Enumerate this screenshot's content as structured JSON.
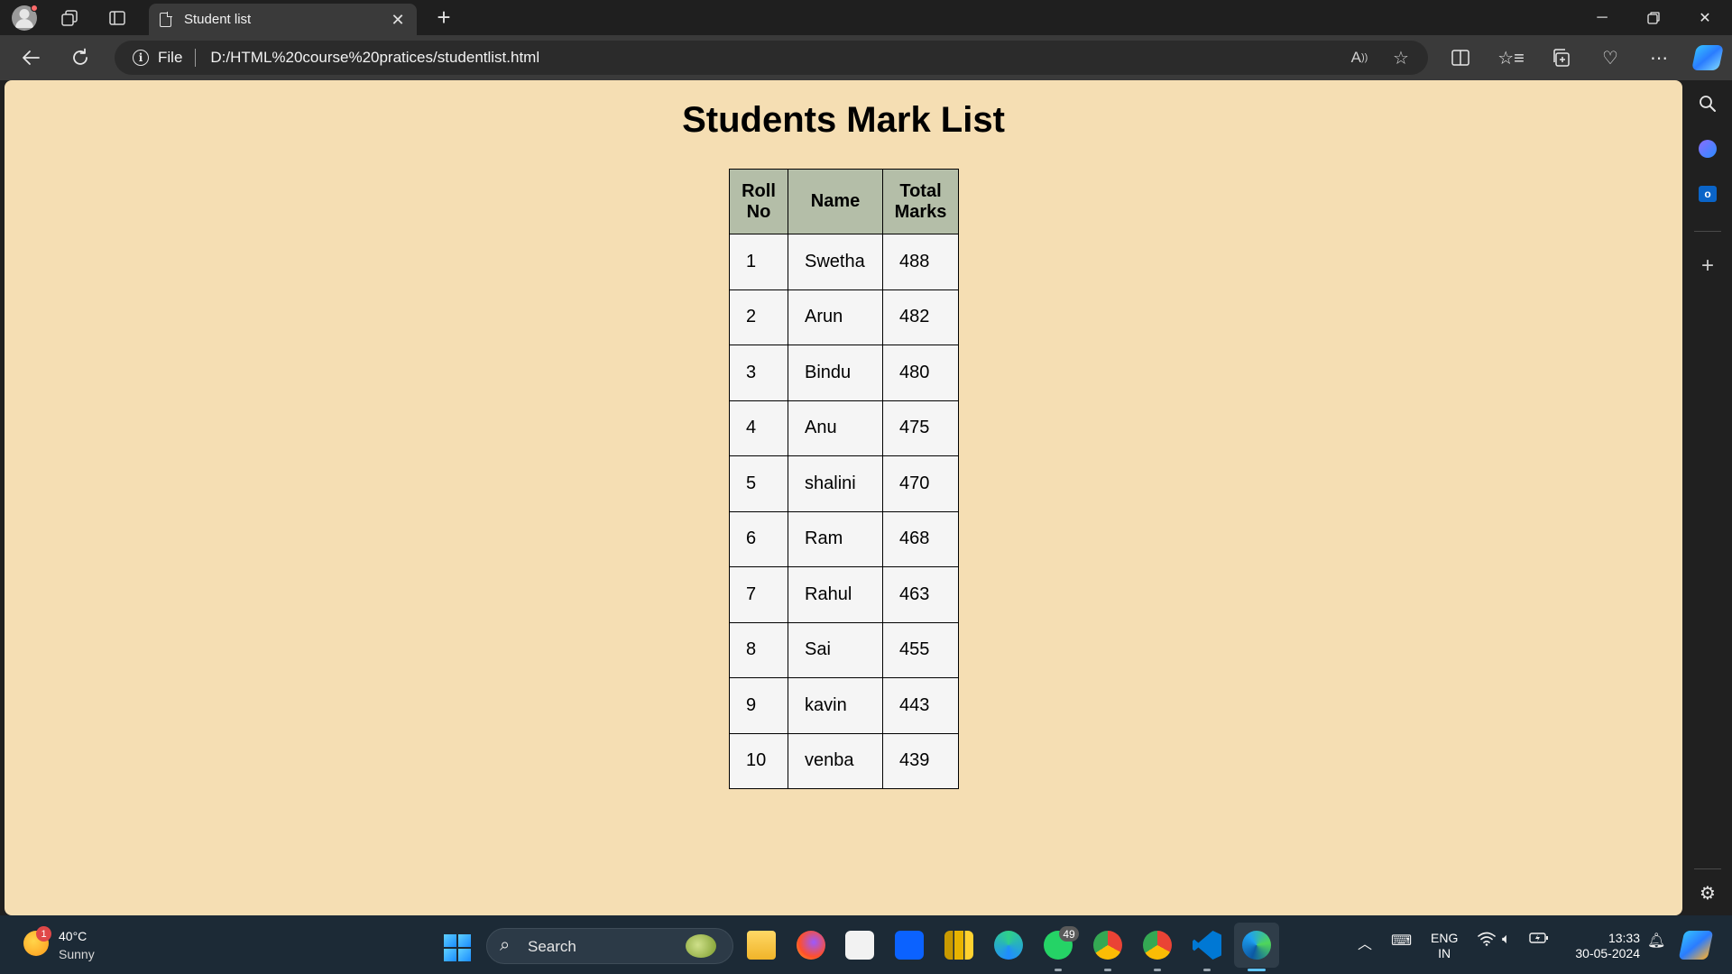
{
  "browser": {
    "tab_title": "Student list",
    "address_scheme": "File",
    "address_url": "D:/HTML%20course%20pratices/studentlist.html"
  },
  "page": {
    "title": "Students Mark List",
    "columns": [
      "Roll No",
      "Name",
      "Total Marks"
    ],
    "rows": [
      {
        "roll": "1",
        "name": "Swetha",
        "total": "488"
      },
      {
        "roll": "2",
        "name": "Arun",
        "total": "482"
      },
      {
        "roll": "3",
        "name": "Bindu",
        "total": "480"
      },
      {
        "roll": "4",
        "name": "Anu",
        "total": "475"
      },
      {
        "roll": "5",
        "name": "shalini",
        "total": "470"
      },
      {
        "roll": "6",
        "name": "Ram",
        "total": "468"
      },
      {
        "roll": "7",
        "name": "Rahul",
        "total": "463"
      },
      {
        "roll": "8",
        "name": "Sai",
        "total": "455"
      },
      {
        "roll": "9",
        "name": "kavin",
        "total": "443"
      },
      {
        "roll": "10",
        "name": "venba",
        "total": "439"
      }
    ],
    "colors": {
      "page_background": "#f5deb3",
      "header_background": "#b4bea8",
      "cell_background": "#f5f5f5"
    }
  },
  "taskbar": {
    "weather_temp": "40°C",
    "weather_condition": "Sunny",
    "weather_badge": "1",
    "search_label": "Search",
    "whatsapp_badge": "49",
    "language_line1": "ENG",
    "language_line2": "IN",
    "time": "13:33",
    "date": "30-05-2024"
  },
  "icons": {
    "titlebar": [
      "profile-icon",
      "workspaces-icon",
      "tab-actions-icon",
      "page-icon",
      "close-icon",
      "new-tab-icon",
      "minimize-icon",
      "restore-icon",
      "window-close-icon"
    ],
    "toolbar": [
      "back-icon",
      "refresh-icon",
      "info-icon",
      "read-aloud-icon",
      "favorite-star-icon",
      "split-screen-icon",
      "favorites-icon",
      "collections-icon",
      "browser-essentials-icon",
      "more-icon",
      "copilot-icon"
    ],
    "sidebar": [
      "search-icon",
      "copilot-sidebar-icon",
      "outlook-icon",
      "add-icon",
      "settings-icon"
    ]
  }
}
